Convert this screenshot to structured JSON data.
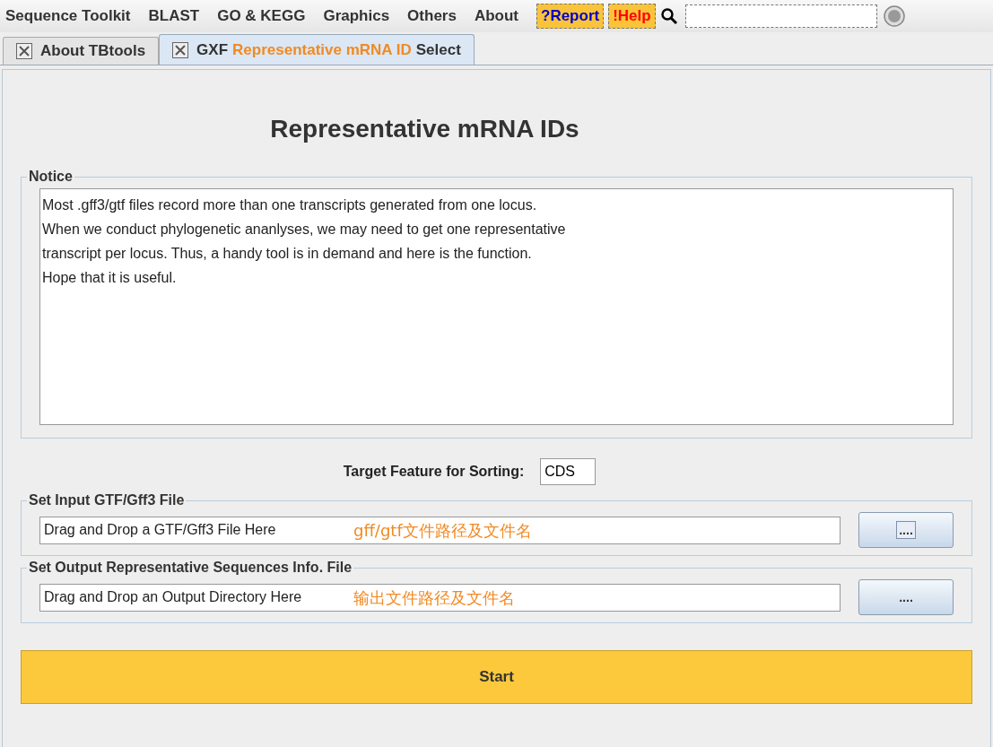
{
  "menu": [
    "Sequence Toolkit",
    "BLAST",
    "GO & KEGG",
    "Graphics",
    "Others",
    "About"
  ],
  "menu_buttons": [
    {
      "label": "?Report",
      "color": "#0000cc"
    },
    {
      "label": "!Help",
      "color": "#ff0000"
    }
  ],
  "tabs": [
    {
      "parts": [
        {
          "text": "About TBtools",
          "highlight": false
        }
      ],
      "selected": false
    },
    {
      "parts": [
        {
          "text": "GXF",
          "highlight": false
        },
        {
          "text": "Representative mRNA ID",
          "highlight": true
        },
        {
          "text": "Select",
          "highlight": false
        }
      ],
      "selected": true
    }
  ],
  "title": "Representative mRNA IDs",
  "notice": {
    "legend": "Notice",
    "lines": [
      "Most .gff3/gtf files record more than one transcripts generated from one locus.",
      "When we conduct phylogenetic ananlyses, we may need to get one representative",
      "transcript per locus. Thus, a handy tool is in demand and here is the function.",
      "Hope that it is useful."
    ]
  },
  "target_feature": {
    "label": "Target Feature for Sorting:",
    "value": "CDS"
  },
  "file_sections": [
    {
      "legend": "Set Input GTF/Gff3 File",
      "value": "Drag and Drop a GTF/Gff3 File Here",
      "annotation": "gff/gtf文件路径及文件名",
      "button": "....",
      "focused": true
    },
    {
      "legend": "Set Output Representative Sequences Info. File",
      "value": "Drag and Drop an Output Directory Here",
      "annotation": "输出文件路径及文件名",
      "button": "....",
      "focused": false
    }
  ],
  "start_button": "Start"
}
